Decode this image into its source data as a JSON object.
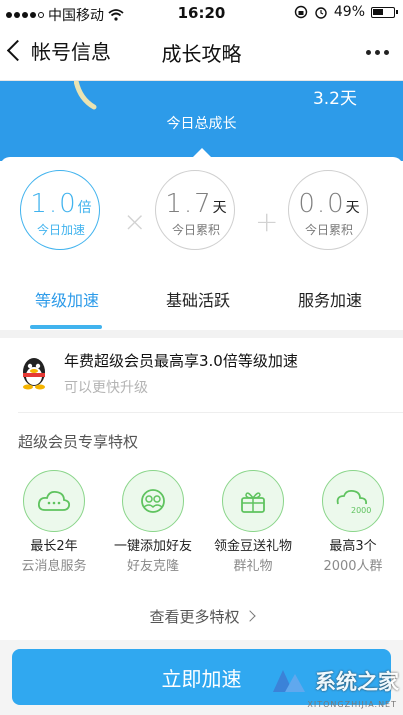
{
  "status_bar": {
    "carrier": "中国移动",
    "time": "16:20",
    "battery": "49%"
  },
  "nav": {
    "back_label": "帐号信息",
    "title": "成长攻略"
  },
  "banner": {
    "days": "3.2天",
    "label": "今日总成长"
  },
  "growth": [
    {
      "value": "1.0",
      "unit": "倍",
      "sub": "今日加速",
      "tab": "等级加速",
      "active": true
    },
    {
      "value": "1.7",
      "unit": "天",
      "sub": "今日累积",
      "tab": "基础活跃",
      "active": false
    },
    {
      "value": "0.0",
      "unit": "天",
      "sub": "今日累积",
      "tab": "服务加速",
      "active": false
    }
  ],
  "operators": [
    "×",
    "+"
  ],
  "promo": {
    "title": "年费超级会员最高享3.0倍等级加速",
    "subtitle": "可以更快升级"
  },
  "privileges": {
    "section_title": "超级会员专享特权",
    "items": [
      {
        "name": "最长2年",
        "desc": "云消息服务",
        "icon": "cloud-message-icon"
      },
      {
        "name": "一键添加好友",
        "desc": "好友克隆",
        "icon": "friend-clone-icon"
      },
      {
        "name": "领金豆送礼物",
        "desc": "群礼物",
        "icon": "group-gift-icon"
      },
      {
        "name": "最高3个",
        "desc": "2000人群",
        "icon": "group-2000-icon",
        "badge": "2000"
      }
    ],
    "more_label": "查看更多特权"
  },
  "accelerate_button": "立即加速",
  "watermark": {
    "text": "系统之家",
    "url": "XITONGZHIJIA.NET"
  },
  "colors": {
    "brand_blue": "#2d9be9",
    "active_ring": "#41b3ee",
    "privilege_green": "#8ad58a",
    "button_blue": "#30a8f0"
  }
}
